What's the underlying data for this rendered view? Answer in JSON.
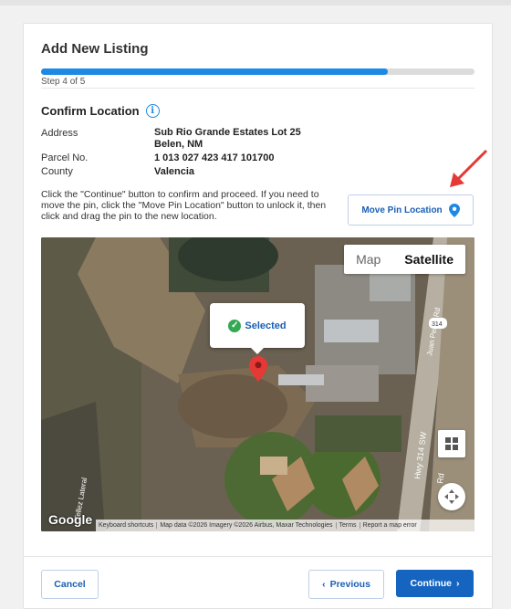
{
  "header": {
    "title": "Add New Listing",
    "progress_fraction": 0.8,
    "step_text": "Step 4 of 5"
  },
  "section": {
    "title": "Confirm Location",
    "info_icon": "info-icon"
  },
  "fields": {
    "address_label": "Address",
    "address_line1": "Sub Rio Grande Estates Lot 25",
    "address_line2": "Belen, NM",
    "parcel_label": "Parcel No.",
    "parcel_value": "1 013 027 423 417 101700",
    "county_label": "County",
    "county_value": "Valencia"
  },
  "instructions": "Click the \"Continue\" button to confirm and proceed. If you need to move the pin, click the \"Move Pin Location\" button to unlock it, then click and drag the pin to the new location.",
  "move_pin_button": {
    "label": "Move Pin Location",
    "icon": "location-pin-icon"
  },
  "map": {
    "toggle_map": "Map",
    "toggle_satellite": "Satellite",
    "selected_label": "Selected",
    "google_logo": "Google",
    "attribution": [
      "Keyboard shortcuts",
      "Map data ©2026 Imagery ©2026 Airbus, Maxar Technologies",
      "Terms",
      "Report a map error"
    ],
    "road_labels": [
      "314",
      "Hwy 314 SW",
      "Juan Perea Rd",
      "Tellez Lateral",
      "Rd"
    ]
  },
  "footer": {
    "cancel": "Cancel",
    "previous": "Previous",
    "continue": "Continue"
  },
  "colors": {
    "accent": "#1e88e5",
    "primary_button": "#1565c0",
    "arrow": "#e53935",
    "pin": "#e53935",
    "check": "#34a853"
  }
}
